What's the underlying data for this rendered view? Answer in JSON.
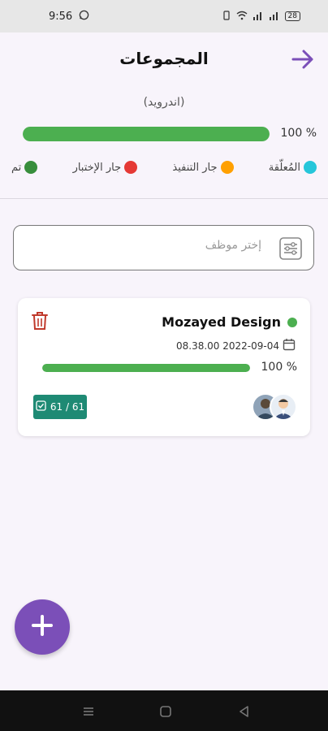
{
  "status_bar": {
    "time": "9:56",
    "battery": "28"
  },
  "header": {
    "title": "المجموعات"
  },
  "subtitle": "(اندرويد)",
  "overall_progress": {
    "value": 1.0,
    "label": "100 %"
  },
  "legend": [
    {
      "label": "المُعلّقة",
      "color": "#26c6da"
    },
    {
      "label": "جار التنفيذ",
      "color": "#ffa000"
    },
    {
      "label": "جار الإختبار",
      "color": "#e53935"
    },
    {
      "label": "تم",
      "color": "#388e3c"
    }
  ],
  "search": {
    "placeholder": "إختر موظف"
  },
  "group": {
    "name": "Mozayed Design",
    "date": "08.38.00 2022-09-04",
    "progress": {
      "value": 1.0,
      "label": "100 %"
    },
    "tasks": "61 / 61",
    "status_color": "#4caf50"
  },
  "colors": {
    "accent": "#7b4fb8",
    "progress": "#4caf50",
    "badge": "#1e8a74",
    "delete": "#c0392b"
  }
}
